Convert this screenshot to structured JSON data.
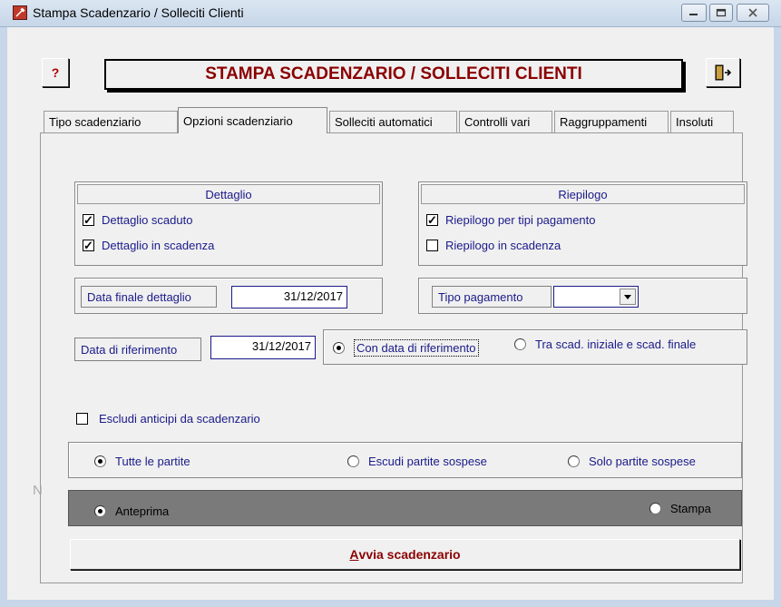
{
  "window": {
    "title": "Stampa Scadenzario / Solleciti Clienti"
  },
  "header": {
    "help_label": "?",
    "title": "STAMPA SCADENZARIO / SOLLECITI CLIENTI"
  },
  "tabs": [
    {
      "label": "Tipo scadenziario",
      "active": false
    },
    {
      "label": "Opzioni scadenziario",
      "active": true
    },
    {
      "label": "Solleciti automatici",
      "active": false
    },
    {
      "label": "Controlli vari",
      "active": false
    },
    {
      "label": "Raggruppamenti",
      "active": false
    },
    {
      "label": "Insoluti",
      "active": false
    }
  ],
  "dettaglio": {
    "title": "Dettaglio",
    "options": [
      {
        "label": "Dettaglio scaduto",
        "checked": true
      },
      {
        "label": "Dettaglio in scadenza",
        "checked": true
      }
    ],
    "data_finale_label": "Data finale dettaglio",
    "data_finale_value": "31/12/2017"
  },
  "riepilogo": {
    "title": "Riepilogo",
    "options": [
      {
        "label": "Riepilogo per tipi pagamento",
        "checked": true
      },
      {
        "label": "Riepilogo in scadenza",
        "checked": false
      }
    ],
    "tipo_pagamento_label": "Tipo pagamento",
    "tipo_pagamento_value": ""
  },
  "riferimento": {
    "label": "Data di riferimento",
    "value": "31/12/2017",
    "options": [
      {
        "label": "Con data di riferimento",
        "selected": true
      },
      {
        "label": "Tra scad. iniziale e scad. finale",
        "selected": false
      }
    ]
  },
  "escludi_anticipi": {
    "label": "Escludi anticipi da scadenzario",
    "checked": false
  },
  "partite": [
    {
      "label": "Tutte le partite",
      "selected": true
    },
    {
      "label": "Escudi  partite sospese",
      "selected": false
    },
    {
      "label": "Solo  partite sospese",
      "selected": false
    }
  ],
  "output": [
    {
      "label": "Anteprima",
      "selected": true
    },
    {
      "label": "Stampa",
      "selected": false
    }
  ],
  "avvia": {
    "prefix": "A",
    "rest": "vvia scadenzario"
  },
  "side_glyph": "N"
}
